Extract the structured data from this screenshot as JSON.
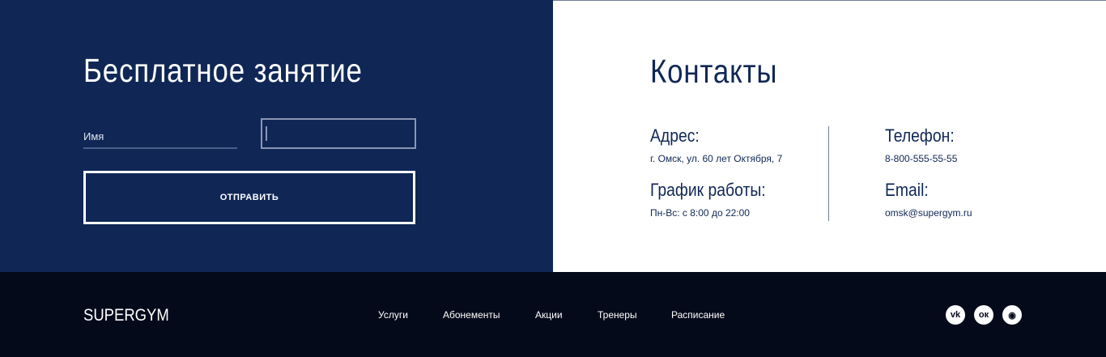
{
  "form": {
    "title": "Бесплатное занятие",
    "name_label": "Имя",
    "submit_label": "ОТПРАВИТЬ"
  },
  "contacts": {
    "title": "Контакты",
    "address_label": "Адрес:",
    "address": "г. Омск, ул. 60 лет Октября, 7",
    "hours_label": "График работы:",
    "hours": "Пн-Вс: с 8:00 до 22:00",
    "phone_label": "Телефон:",
    "phone": "8-800-555-55-55",
    "email_label": "Email:",
    "email": "omsk@supergym.ru"
  },
  "footer": {
    "logo": "SUPERGYM",
    "nav": [
      "Услуги",
      "Абонементы",
      "Акции",
      "Тренеры",
      "Расписание"
    ],
    "social": [
      {
        "icon": "vk-icon",
        "glyph": "vk"
      },
      {
        "icon": "odnoklassniki-icon",
        "glyph": "ок"
      },
      {
        "icon": "reddit-icon",
        "glyph": "◉"
      }
    ]
  },
  "colors": {
    "primary": "#102756",
    "footer": "#050a1a"
  }
}
